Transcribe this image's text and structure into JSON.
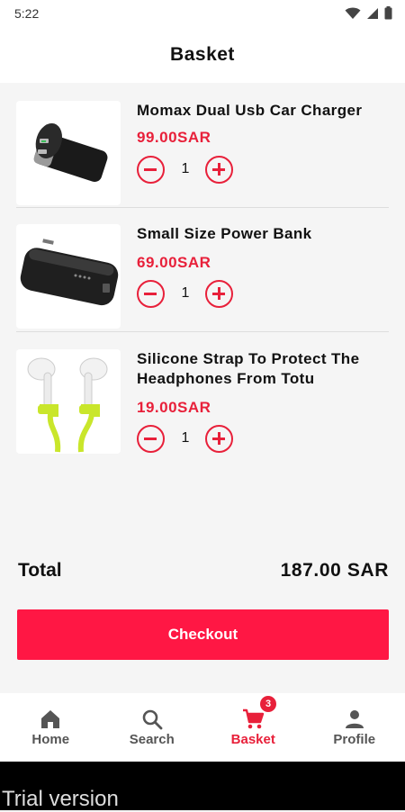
{
  "status_bar": {
    "time": "5:22"
  },
  "header": {
    "title": "Basket"
  },
  "items": [
    {
      "title": "Momax Dual Usb Car Charger",
      "price": "99.00SAR",
      "quantity": "1",
      "image": "car-charger"
    },
    {
      "title": "Small Size Power Bank",
      "price": "69.00SAR",
      "quantity": "1",
      "image": "power-bank"
    },
    {
      "title": "Silicone Strap To Protect The Headphones From Totu",
      "price": "19.00SAR",
      "quantity": "1",
      "image": "earbuds-strap"
    }
  ],
  "summary": {
    "total_label": "Total",
    "total_value": "187.00 SAR"
  },
  "checkout_label": "Checkout",
  "nav": [
    {
      "label": "Home",
      "icon": "home-icon"
    },
    {
      "label": "Search",
      "icon": "search-icon"
    },
    {
      "label": "Basket",
      "icon": "cart-icon",
      "badge": "3",
      "active": true
    },
    {
      "label": "Profile",
      "icon": "profile-icon"
    }
  ],
  "watermark": "Trial version",
  "colors": {
    "accent": "#e8203a",
    "checkout": "#ff1744"
  }
}
